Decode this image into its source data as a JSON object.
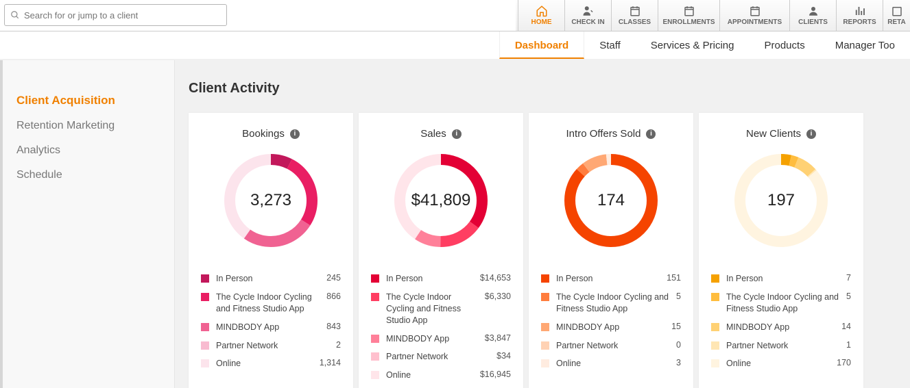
{
  "search": {
    "placeholder": "Search for or jump to a client"
  },
  "topnav": {
    "home": "HOME",
    "checkin": "CHECK IN",
    "classes": "CLASSES",
    "enrollments": "ENROLLMENTS",
    "appointments": "APPOINTMENTS",
    "clients": "CLIENTS",
    "reports": "REPORTS",
    "retail": "RETA"
  },
  "subnav": {
    "dashboard": "Dashboard",
    "staff": "Staff",
    "services": "Services & Pricing",
    "products": "Products",
    "manager": "Manager Too"
  },
  "sidebar": {
    "acquisition": "Client Acquisition",
    "retention": "Retention Marketing",
    "analytics": "Analytics",
    "schedule": "Schedule"
  },
  "page": {
    "title": "Client Activity"
  },
  "cards": {
    "bookings": {
      "title": "Bookings",
      "total": "3,273",
      "items": [
        {
          "label": "In Person",
          "value": "245"
        },
        {
          "label": "The Cycle Indoor Cycling and Fitness Studio App",
          "value": "866"
        },
        {
          "label": "MINDBODY App",
          "value": "843"
        },
        {
          "label": "Partner Network",
          "value": "2"
        },
        {
          "label": "Online",
          "value": "1,314"
        }
      ]
    },
    "sales": {
      "title": "Sales",
      "total": "$41,809",
      "items": [
        {
          "label": "In Person",
          "value": "$14,653"
        },
        {
          "label": "The Cycle Indoor Cycling and Fitness Studio App",
          "value": "$6,330"
        },
        {
          "label": "MINDBODY App",
          "value": "$3,847"
        },
        {
          "label": "Partner Network",
          "value": "$34"
        },
        {
          "label": "Online",
          "value": "$16,945"
        }
      ]
    },
    "intro": {
      "title": "Intro Offers Sold",
      "total": "174",
      "items": [
        {
          "label": "In Person",
          "value": "151"
        },
        {
          "label": "The Cycle Indoor Cycling and Fitness Studio App",
          "value": "5"
        },
        {
          "label": "MINDBODY App",
          "value": "15"
        },
        {
          "label": "Partner Network",
          "value": "0"
        },
        {
          "label": "Online",
          "value": "3"
        }
      ]
    },
    "newclients": {
      "title": "New Clients",
      "total": "197",
      "items": [
        {
          "label": "In Person",
          "value": "7"
        },
        {
          "label": "The Cycle Indoor Cycling and Fitness Studio App",
          "value": "5"
        },
        {
          "label": "MINDBODY App",
          "value": "14"
        },
        {
          "label": "Partner Network",
          "value": "1"
        },
        {
          "label": "Online",
          "value": "170"
        }
      ]
    }
  },
  "chart_data": [
    {
      "type": "pie",
      "title": "Bookings",
      "total": 3273,
      "series": [
        {
          "name": "In Person",
          "value": 245
        },
        {
          "name": "The Cycle Indoor Cycling and Fitness Studio App",
          "value": 866
        },
        {
          "name": "MINDBODY App",
          "value": 843
        },
        {
          "name": "Partner Network",
          "value": 2
        },
        {
          "name": "Online",
          "value": 1314
        }
      ],
      "palette": [
        "#c2185b",
        "#e91e63",
        "#f06292",
        "#f8bbd0",
        "#fce4ec"
      ]
    },
    {
      "type": "pie",
      "title": "Sales",
      "total": 41809,
      "series": [
        {
          "name": "In Person",
          "value": 14653
        },
        {
          "name": "The Cycle Indoor Cycling and Fitness Studio App",
          "value": 6330
        },
        {
          "name": "MINDBODY App",
          "value": 3847
        },
        {
          "name": "Partner Network",
          "value": 34
        },
        {
          "name": "Online",
          "value": 16945
        }
      ],
      "palette": [
        "#e30035",
        "#ff3e62",
        "#ff8099",
        "#ffc0ce",
        "#ffe5ea"
      ]
    },
    {
      "type": "pie",
      "title": "Intro Offers Sold",
      "total": 174,
      "series": [
        {
          "name": "In Person",
          "value": 151
        },
        {
          "name": "The Cycle Indoor Cycling and Fitness Studio App",
          "value": 5
        },
        {
          "name": "MINDBODY App",
          "value": 15
        },
        {
          "name": "Partner Network",
          "value": 0
        },
        {
          "name": "Online",
          "value": 3
        }
      ],
      "palette": [
        "#f54400",
        "#ff7d3e",
        "#ffa874",
        "#ffd2b4",
        "#ffece0"
      ]
    },
    {
      "type": "pie",
      "title": "New Clients",
      "total": 197,
      "series": [
        {
          "name": "In Person",
          "value": 7
        },
        {
          "name": "The Cycle Indoor Cycling and Fitness Studio App",
          "value": 5
        },
        {
          "name": "MINDBODY App",
          "value": 14
        },
        {
          "name": "Partner Network",
          "value": 1
        },
        {
          "name": "Online",
          "value": 170
        }
      ],
      "palette": [
        "#f5a100",
        "#ffbd3e",
        "#ffd174",
        "#ffe6b4",
        "#fff4e0"
      ]
    }
  ]
}
